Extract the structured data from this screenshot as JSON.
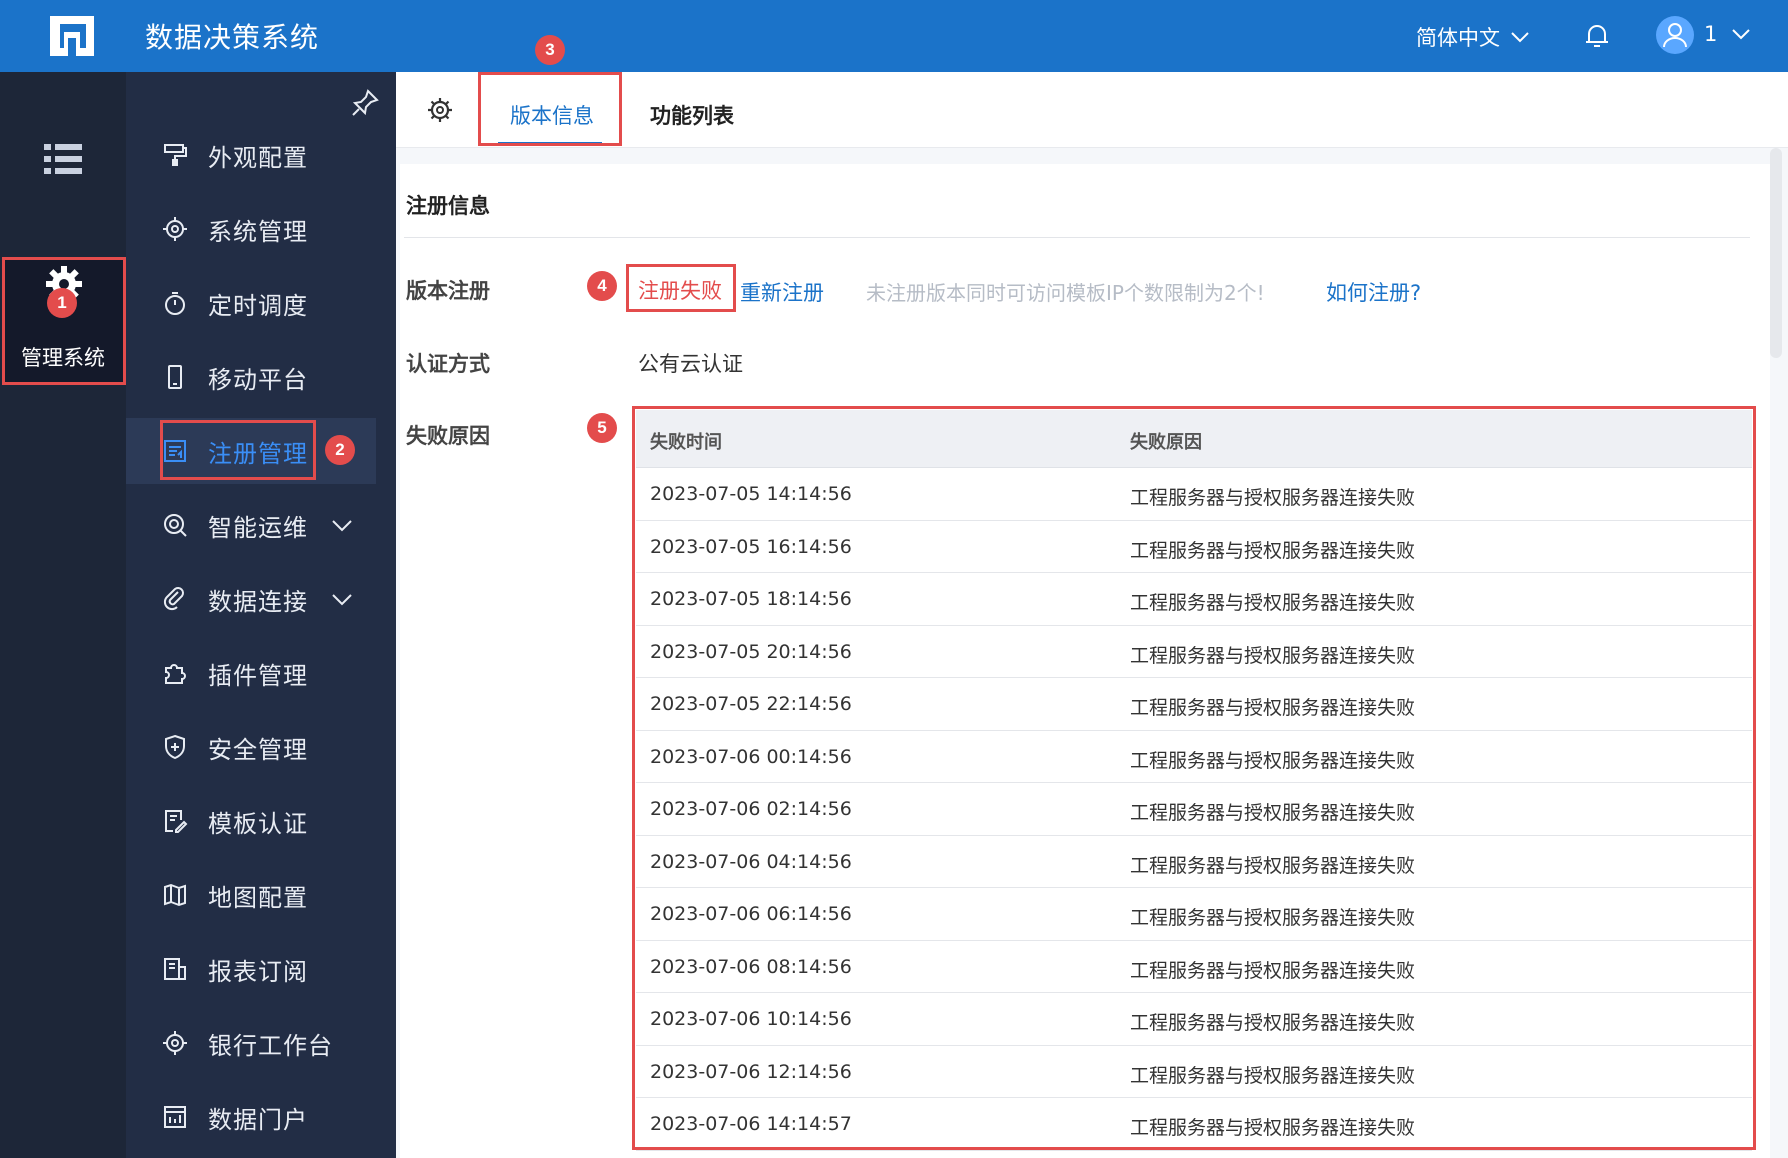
{
  "header": {
    "title": "数据决策系统",
    "language": "简体中文",
    "user": "1"
  },
  "rail": {
    "directory_label": "目录",
    "manage_label": "管理系统"
  },
  "menu": {
    "items": [
      {
        "label": "外观配置",
        "icon": "paint-roller-icon"
      },
      {
        "label": "系统管理",
        "icon": "gear-icon"
      },
      {
        "label": "定时调度",
        "icon": "timer-icon"
      },
      {
        "label": "移动平台",
        "icon": "mobile-icon"
      },
      {
        "label": "注册管理",
        "icon": "register-icon",
        "active": true
      },
      {
        "label": "智能运维",
        "icon": "ops-icon",
        "expandable": true
      },
      {
        "label": "数据连接",
        "icon": "link-icon",
        "expandable": true
      },
      {
        "label": "插件管理",
        "icon": "puzzle-icon"
      },
      {
        "label": "安全管理",
        "icon": "shield-icon"
      },
      {
        "label": "模板认证",
        "icon": "certificate-icon"
      },
      {
        "label": "地图配置",
        "icon": "map-icon"
      },
      {
        "label": "报表订阅",
        "icon": "subscription-icon"
      },
      {
        "label": "银行工作台",
        "icon": "gear-icon"
      },
      {
        "label": "数据门户",
        "icon": "portal-icon"
      }
    ]
  },
  "badges": {
    "b1": "1",
    "b2": "2",
    "b3": "3",
    "b4": "4",
    "b5": "5"
  },
  "tabs": {
    "version_info": "版本信息",
    "feature_list": "功能列表"
  },
  "registration": {
    "section_title": "注册信息",
    "version_label": "版本注册",
    "status": "注册失败",
    "re_register": "重新注册",
    "hint": "未注册版本同时可访问模板IP个数限制为2个!",
    "how_to": "如何注册?",
    "auth_label": "认证方式",
    "auth_value": "公有云认证",
    "failure_label": "失败原因"
  },
  "failure_table": {
    "headers": [
      "失败时间",
      "失败原因"
    ],
    "rows": [
      [
        "2023-07-05 14:14:56",
        "工程服务器与授权服务器连接失败"
      ],
      [
        "2023-07-05 16:14:56",
        "工程服务器与授权服务器连接失败"
      ],
      [
        "2023-07-05 18:14:56",
        "工程服务器与授权服务器连接失败"
      ],
      [
        "2023-07-05 20:14:56",
        "工程服务器与授权服务器连接失败"
      ],
      [
        "2023-07-05 22:14:56",
        "工程服务器与授权服务器连接失败"
      ],
      [
        "2023-07-06 00:14:56",
        "工程服务器与授权服务器连接失败"
      ],
      [
        "2023-07-06 02:14:56",
        "工程服务器与授权服务器连接失败"
      ],
      [
        "2023-07-06 04:14:56",
        "工程服务器与授权服务器连接失败"
      ],
      [
        "2023-07-06 06:14:56",
        "工程服务器与授权服务器连接失败"
      ],
      [
        "2023-07-06 08:14:56",
        "工程服务器与授权服务器连接失败"
      ],
      [
        "2023-07-06 10:14:56",
        "工程服务器与授权服务器连接失败"
      ],
      [
        "2023-07-06 12:14:56",
        "工程服务器与授权服务器连接失败"
      ],
      [
        "2023-07-06 14:14:57",
        "工程服务器与授权服务器连接失败"
      ]
    ]
  },
  "colors": {
    "header_bg": "#1b73c9",
    "rail_bg": "#1d2638",
    "menu_bg": "#222d45",
    "accent": "#1b73c9",
    "annotation_red": "#e34c4c"
  }
}
